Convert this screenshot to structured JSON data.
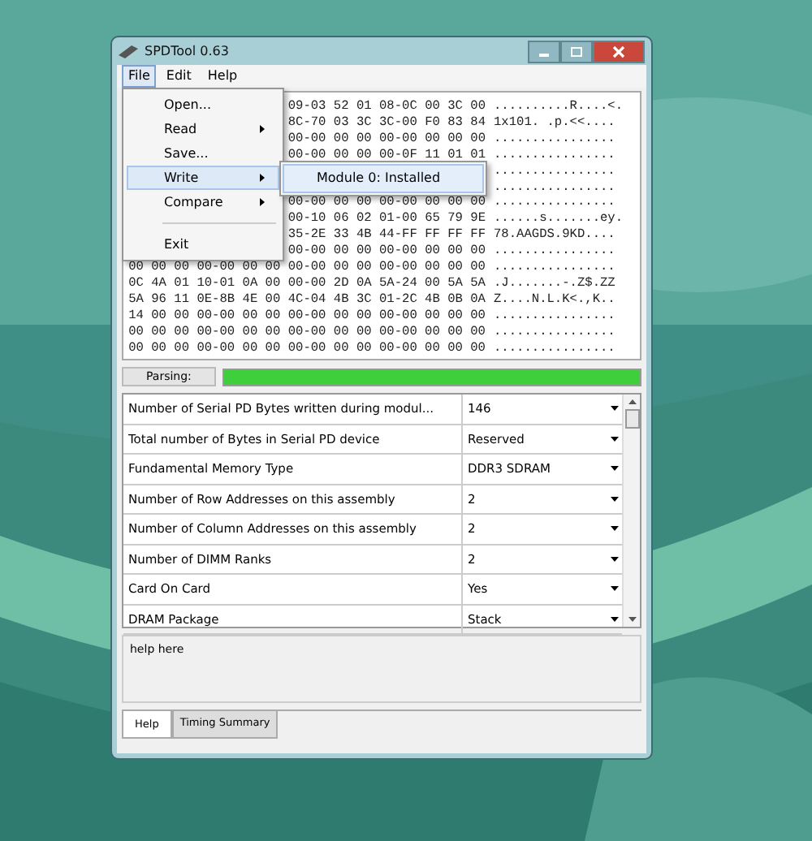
{
  "window": {
    "title": "SPDTool 0.63"
  },
  "menu_bar": [
    {
      "label": "File",
      "selected": true
    },
    {
      "label": "Edit",
      "selected": false
    },
    {
      "label": "Help",
      "selected": false
    }
  ],
  "file_menu": [
    {
      "label": "Open...",
      "submenu": false,
      "selected": false
    },
    {
      "label": "Read",
      "submenu": true,
      "selected": false
    },
    {
      "label": "Save...",
      "submenu": false,
      "selected": false
    },
    {
      "label": "Write",
      "submenu": true,
      "selected": true
    },
    {
      "label": "Compare",
      "submenu": true,
      "selected": false
    },
    {
      "kind": "separator"
    },
    {
      "label": "Exit",
      "submenu": false,
      "selected": false
    }
  ],
  "submenu": [
    "Module 0: Installed"
  ],
  "hex_dump": [
    {
      "hex": "09-03 52 01 08-0C 00 3C 00",
      "ascii": "..........R....<."
    },
    {
      "hex": "8C-70 03 3C 3C-00 F0 83 84",
      "ascii": "1x101. .p.<<...."
    },
    {
      "hex": "00-00 00 00 00-00 00 00 00",
      "ascii": "................"
    },
    {
      "hex": "00-00 00 00 00-0F 11 01 01",
      "ascii": "................"
    },
    {
      "ascii": "................"
    },
    {
      "ascii": "................"
    },
    {
      "hex": "00-00 00 00 00-00 00 00 00",
      "ascii": "................"
    },
    {
      "hex": "00-10 06 02 01-00 65 79 9E",
      "ascii": "......s.......ey."
    },
    {
      "hex": "35-2E 33 4B 44-FF FF FF FF",
      "ascii": "78.AAGDS.9KD...."
    },
    {
      "hex": "00-00 00 00 00-00 00 00 00",
      "ascii": "................"
    },
    {
      "hex": "00 00 00 00-00 00 00 00-00 00 00 00-00 00 00 00",
      "ascii": "................"
    },
    {
      "hex": "0C 4A 01 10-01 0A 00 00-00 2D 0A 5A-24 00 5A 5A",
      "ascii": ".J.......-.Z$.ZZ"
    },
    {
      "hex": "5A 96 11 0E-8B 4E 00 4C-04 4B 3C 01-2C 4B 0B 0A",
      "ascii": "Z....N.L.K<.,K.."
    },
    {
      "hex": "14 00 00 00-00 00 00 00-00 00 00 00-00 00 00 00",
      "ascii": "................"
    },
    {
      "hex": "00 00 00 00-00 00 00 00-00 00 00 00-00 00 00 00",
      "ascii": "................"
    },
    {
      "hex": "00 00 00 00-00 00 00 00-00 00 00 00-00 00 00 00",
      "ascii": "................"
    }
  ],
  "parsing": {
    "label": "Parsing:",
    "level": 1
  },
  "properties": [
    {
      "name": "Number of Serial PD Bytes written during modul...",
      "value": "146"
    },
    {
      "name": "Total number of Bytes in Serial PD device",
      "value": "Reserved"
    },
    {
      "name": "Fundamental Memory Type",
      "value": "DDR3 SDRAM"
    },
    {
      "name": "Number of Row Addresses on this assembly",
      "value": "2"
    },
    {
      "name": "Number of Column Addresses on this assembly",
      "value": "2"
    },
    {
      "name": "Number of DIMM Ranks",
      "value": "2"
    },
    {
      "name": "Card On Card",
      "value": "Yes"
    },
    {
      "name": "DRAM Package",
      "value": "Stack"
    }
  ],
  "help_text": "help here",
  "tabs": [
    {
      "label": "Help",
      "selected": true
    },
    {
      "label": "Timing Summary",
      "selected": false
    }
  ]
}
